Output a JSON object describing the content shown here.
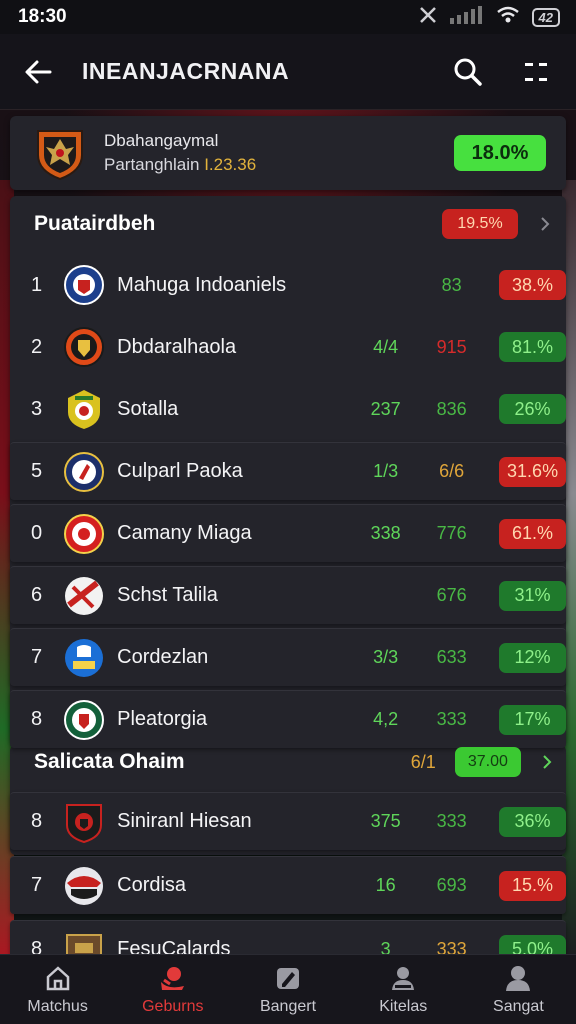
{
  "status_bar": {
    "time": "18:30",
    "battery": "42"
  },
  "app_bar": {
    "title": "INEANJACRNANA"
  },
  "summary": {
    "title": "Dbahangaymal",
    "subtitle_prefix": "Partanghlain",
    "subtitle_highlight": "I.23.36",
    "value": "18.0%"
  },
  "group1": {
    "title": "Puatairdbeh",
    "value": "19.5%",
    "rows": [
      {
        "rank": "1",
        "team": "Mahuga Indoaniels",
        "stat_a": "",
        "stat_b": "83",
        "stat_b_color": "g",
        "pct": "38.%",
        "pct_color": "red",
        "crest": "crest-navy"
      },
      {
        "rank": "2",
        "team": "Dbdaralhaola",
        "stat_a": "4/4",
        "stat_b": "915",
        "stat_b_color": "r",
        "pct": "81.%",
        "pct_color": "green",
        "crest": "crest-red"
      },
      {
        "rank": "3",
        "team": "Sotalla",
        "stat_a": "237",
        "stat_b": "836",
        "stat_b_color": "g",
        "pct": "26%",
        "pct_color": "green",
        "crest": "crest-gold"
      },
      {
        "rank": "5",
        "team": "Culparl Paoka",
        "stat_a": "1/3",
        "stat_b": "6/6",
        "stat_b_color": "o",
        "pct": "31.6%",
        "pct_color": "red",
        "crest": "crest-navy-red"
      },
      {
        "rank": "0",
        "team": "Camany Miaga",
        "stat_a": "338",
        "stat_b": "776",
        "stat_b_color": "g",
        "pct": "61.%",
        "pct_color": "red",
        "crest": "crest-red-ring"
      },
      {
        "rank": "6",
        "team": "Schst Talila",
        "stat_a": "",
        "stat_b": "676",
        "stat_b_color": "g",
        "pct": "31%",
        "pct_color": "green",
        "crest": "crest-white-red"
      },
      {
        "rank": "7",
        "team": "Cordezlan",
        "stat_a": "3/3",
        "stat_b": "633",
        "stat_b_color": "g",
        "pct": "12%",
        "pct_color": "green",
        "crest": "crest-blue"
      },
      {
        "rank": "8",
        "team": "Pleatorgia",
        "stat_a": "4,2",
        "stat_b": "333",
        "stat_b_color": "g",
        "pct": "17%",
        "pct_color": "green",
        "crest": "crest-green"
      }
    ]
  },
  "group2": {
    "title": "Salicata Ohaim",
    "stat": "6/1",
    "value": "37.00",
    "rows": [
      {
        "rank": "8",
        "team": "Siniranl Hiesan",
        "stat_a": "375",
        "stat_b": "333",
        "stat_b_color": "g",
        "pct": "36%",
        "pct_color": "green",
        "crest": "crest-black-red"
      },
      {
        "rank": "7",
        "team": "Cordisa",
        "stat_a": "16",
        "stat_b": "693",
        "stat_b_color": "g",
        "pct": "15.%",
        "pct_color": "red",
        "crest": "crest-mask"
      },
      {
        "rank": "8",
        "team": "FesuCalards",
        "stat_a": "3",
        "stat_b": "333",
        "stat_b_color": "o",
        "pct": "5.0%",
        "pct_color": "green",
        "crest": "crest-brown"
      }
    ]
  },
  "bottom_nav": [
    {
      "label": "Matchus",
      "icon": "home-icon",
      "active": false
    },
    {
      "label": "Geburns",
      "icon": "ball-icon",
      "active": true
    },
    {
      "label": "Bangert",
      "icon": "edit-icon",
      "active": false
    },
    {
      "label": "Kitelas",
      "icon": "user-group-icon",
      "active": false
    },
    {
      "label": "Sangat",
      "icon": "profile-icon",
      "active": false
    }
  ],
  "colors": {
    "accent_red": "#e23a3a",
    "pill_green": "#1f7a2c",
    "pill_red": "#c7221f",
    "pill_lime": "#47e03f"
  }
}
